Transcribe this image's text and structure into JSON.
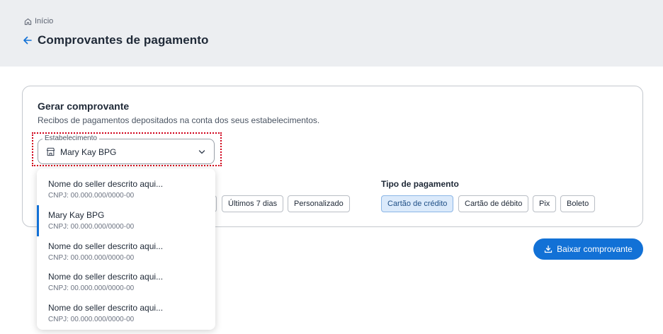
{
  "breadcrumb": {
    "home_label": "Início"
  },
  "header": {
    "title": "Comprovantes de pagamento"
  },
  "card": {
    "title": "Gerar comprovante",
    "description": "Recibos de pagamentos depositados na conta dos seus estabelecimentos."
  },
  "establishment_select": {
    "label": "Estabelecimento",
    "value": "Mary Kay BPG"
  },
  "dropdown": {
    "items": [
      {
        "name": "Nome do seller descrito aqui...",
        "cnpj": "CNPJ: 00.000.000/0000-00"
      },
      {
        "name": "Mary Kay BPG",
        "cnpj": "CNPJ: 00.000.000/0000-00",
        "selected": true
      },
      {
        "name": "Nome do seller descrito aqui...",
        "cnpj": "CNPJ: 00.000.000/0000-00"
      },
      {
        "name": "Nome do seller descrito aqui...",
        "cnpj": "CNPJ: 00.000.000/0000-00"
      },
      {
        "name": "Nome do seller descrito aqui...",
        "cnpj": "CNPJ: 00.000.000/0000-00"
      }
    ]
  },
  "period_chips": [
    "Últimos 7 dias",
    "Personalizado"
  ],
  "payment_type": {
    "label": "Tipo de pagamento",
    "chips": [
      "Cartão de crédito",
      "Cartão de débito",
      "Pix",
      "Boleto"
    ],
    "selected": "Cartão de crédito"
  },
  "download_button": {
    "label": "Baixar comprovante"
  },
  "colors": {
    "accent": "#1271d6",
    "focus_outline": "#d0021b",
    "header_bg": "#eceef1"
  }
}
